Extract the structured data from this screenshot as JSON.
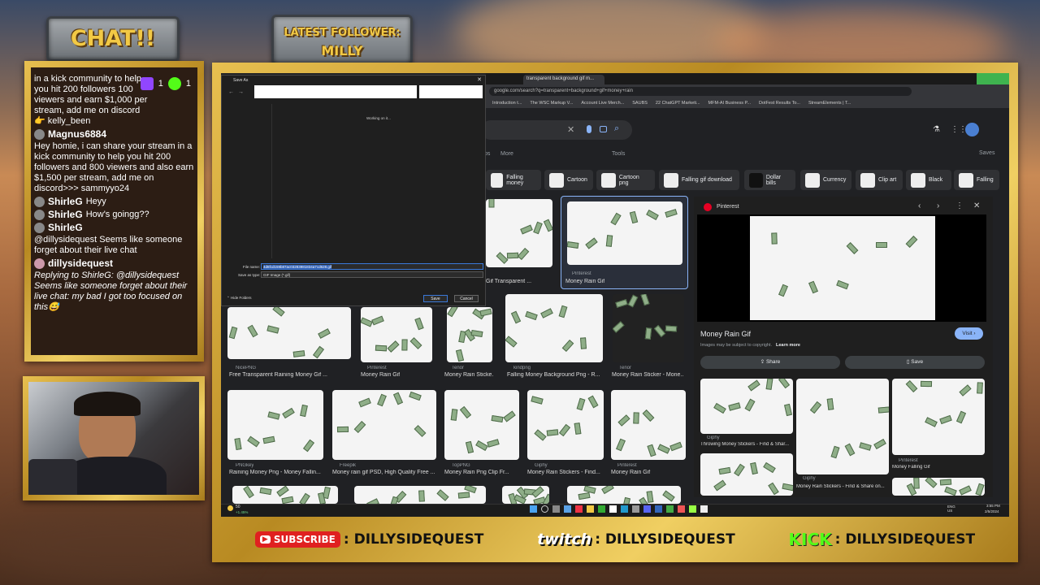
{
  "overlay": {
    "chat_title": "CHAT!!",
    "latest_follower_label": "LATEST FOLLOWER:",
    "latest_follower_name": "MILLY",
    "chat_counts": {
      "twitch": "1",
      "kick": "1"
    },
    "chat_messages": [
      {
        "user": "",
        "text": "in a kick community to help you hit 200 followers 100 viewers and earn $1,000 per stream, add me on discord 👉 kelly_been"
      },
      {
        "user": "Magnus6884",
        "text": "Hey homie, i can share your stream in a kick community to help you hit 200 followers and 800 viewers and also earn $1,500 per stream, add me on discord>>> sammyyo24"
      },
      {
        "user": "ShirleG",
        "text": "Heyy"
      },
      {
        "user": "ShirleG",
        "text": "How's goingg??"
      },
      {
        "user": "ShirleG",
        "text": "@dillysidequest Seems like someone forget about their live chat"
      },
      {
        "user": "dillysidequest",
        "text": "Replying to ShirleG: @dillysidequest Seems like someone forget about their live chat: my bad I got too focused on this😅"
      }
    ],
    "social": [
      {
        "label": "SUBSCRIBE",
        "handle": ": DILLYSIDEQUEST"
      },
      {
        "label": "twitch",
        "handle": ": DILLYSIDEQUEST"
      },
      {
        "label": "KICK",
        "handle": ": DILLYSIDEQUEST"
      }
    ]
  },
  "browser": {
    "tab_title": "transparent background gif m...",
    "url": "google.com/search?q=transparent+background+gif+money+rain",
    "bookmarks": [
      "Introduction t...",
      "The WSC Markup V...",
      "Account Live Merch...",
      "SAUBS",
      "22 ChatGPT Marketi...",
      "MFM-AI Business P...",
      "DotFest Results To...",
      "StreamElements | T..."
    ],
    "search_tabs": [
      "os",
      "More",
      "Tools",
      "Saves"
    ],
    "chips": [
      "Falling money",
      "Cartoon",
      "Cartoon png",
      "Falling gif download",
      "Dollar bills",
      "Currency",
      "Clip art",
      "Black",
      "Falling"
    ],
    "results": [
      {
        "source": "",
        "title": "Gif Transparent ..."
      },
      {
        "source": "Pinterest",
        "title": "Money Rain Gif"
      },
      {
        "source": "NicePNG",
        "title": "Free Transparent Raining Money Gif ..."
      },
      {
        "source": "Pinterest",
        "title": "Money Rain Gif"
      },
      {
        "source": "Tenor",
        "title": "Money Rain Sticke..."
      },
      {
        "source": "kindpng",
        "title": "Falling Money Background Png - R..."
      },
      {
        "source": "Tenor",
        "title": "Money Rain Sticker - Mone..."
      },
      {
        "source": "PNGkey",
        "title": "Raining Money Png - Money Fallin..."
      },
      {
        "source": "Freepik",
        "title": "Money rain gif PSD, High Quality Free ..."
      },
      {
        "source": "TopPNG",
        "title": "Money Rain Png Clip Fr..."
      },
      {
        "source": "Giphy",
        "title": "Money Rain Stickers - Find..."
      },
      {
        "source": "Pinterest",
        "title": "Money Rain Gif"
      }
    ],
    "preview": {
      "source": "Pinterest",
      "title": "Money Rain Gif",
      "copyright": "Images may be subject to copyright.",
      "learn_more": "Learn more",
      "visit": "Visit",
      "share": "Share",
      "save": "Save",
      "related": [
        {
          "source": "Giphy",
          "title": "Throwing Money Stickers - Find & Shar..."
        },
        {
          "source": "Giphy",
          "title": "Money Rain Stickers - Find & Share on..."
        },
        {
          "source": "Pinterest",
          "title": "Money Falling Gif"
        }
      ]
    }
  },
  "save_dialog": {
    "title": "Save As",
    "status": "Working on it...",
    "filename_label": "File name:",
    "filename_value": "4d6fcd159b87ac03283981834a7cd628.gif",
    "type_label": "Save as type:",
    "type_value": "GIF Image (*.gif)",
    "hide_folders": "Hide Folders",
    "save": "Save",
    "cancel": "Cancel"
  },
  "taskbar": {
    "weather": "50",
    "weather_sub": "+1.45%",
    "lang": "ENG\nUS",
    "time": "3:55 PM",
    "date": "2/5/2024"
  }
}
